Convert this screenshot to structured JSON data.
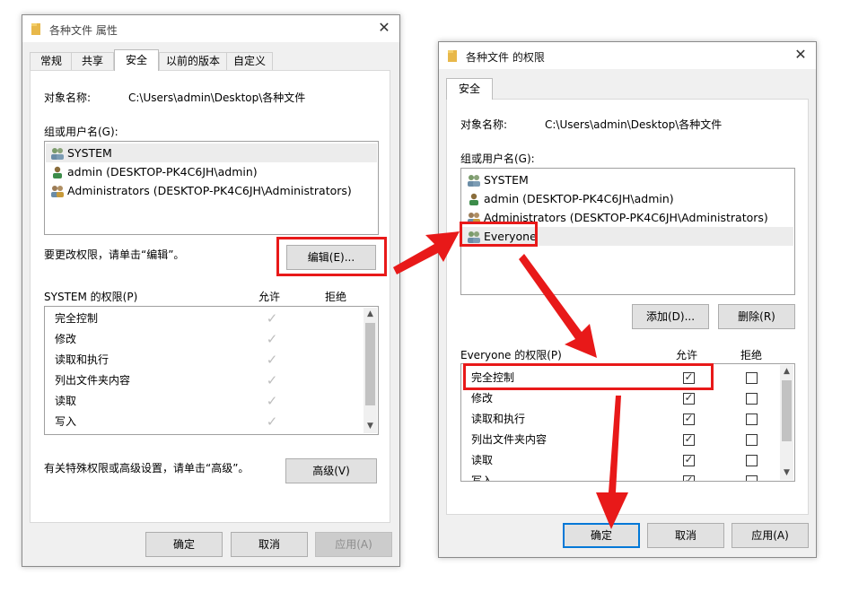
{
  "left_window": {
    "title": "各种文件 属性",
    "tabs": [
      "常规",
      "共享",
      "安全",
      "以前的版本",
      "自定义"
    ],
    "active_tab": "安全",
    "object_label": "对象名称:",
    "object_path": "C:\\Users\\admin\\Desktop\\各种文件",
    "group_label": "组或用户名(G):",
    "users": [
      {
        "name": "SYSTEM",
        "icon": "users-group-icon"
      },
      {
        "name": "admin (DESKTOP-PK4C6JH\\admin)",
        "icon": "user-icon"
      },
      {
        "name": "Administrators (DESKTOP-PK4C6JH\\Administrators)",
        "icon": "users-group-icon"
      }
    ],
    "edit_hint": "要更改权限，请单击“编辑”。",
    "edit_button": "编辑(E)...",
    "perm_title": "SYSTEM 的权限(P)",
    "allow_label": "允许",
    "deny_label": "拒绝",
    "permissions": [
      "完全控制",
      "修改",
      "读取和执行",
      "列出文件夹内容",
      "读取",
      "写入"
    ],
    "advanced_hint": "有关特殊权限或高级设置，请单击“高级”。",
    "advanced_button": "高级(V)",
    "ok_button": "确定",
    "cancel_button": "取消",
    "apply_button": "应用(A)"
  },
  "right_window": {
    "title": "各种文件 的权限",
    "tab": "安全",
    "object_label": "对象名称:",
    "object_path": "C:\\Users\\admin\\Desktop\\各种文件",
    "group_label": "组或用户名(G):",
    "users": [
      {
        "name": "SYSTEM",
        "icon": "users-group-icon"
      },
      {
        "name": "admin (DESKTOP-PK4C6JH\\admin)",
        "icon": "user-icon"
      },
      {
        "name": "Administrators (DESKTOP-PK4C6JH\\Administrators)",
        "icon": "users-group-icon"
      },
      {
        "name": "Everyone",
        "icon": "users-group-icon"
      }
    ],
    "add_button": "添加(D)...",
    "remove_button": "删除(R)",
    "perm_title": "Everyone 的权限(P)",
    "allow_label": "允许",
    "deny_label": "拒绝",
    "permissions": [
      {
        "name": "完全控制",
        "allow": true,
        "deny": false
      },
      {
        "name": "修改",
        "allow": true,
        "deny": false
      },
      {
        "name": "读取和执行",
        "allow": true,
        "deny": false
      },
      {
        "name": "列出文件夹内容",
        "allow": true,
        "deny": false
      },
      {
        "name": "读取",
        "allow": true,
        "deny": false
      },
      {
        "name": "写入",
        "allow": true,
        "deny": false
      }
    ],
    "ok_button": "确定",
    "cancel_button": "取消",
    "apply_button": "应用(A)"
  },
  "colors": {
    "highlight_red": "#e81919",
    "primary_border": "#0078d7"
  }
}
